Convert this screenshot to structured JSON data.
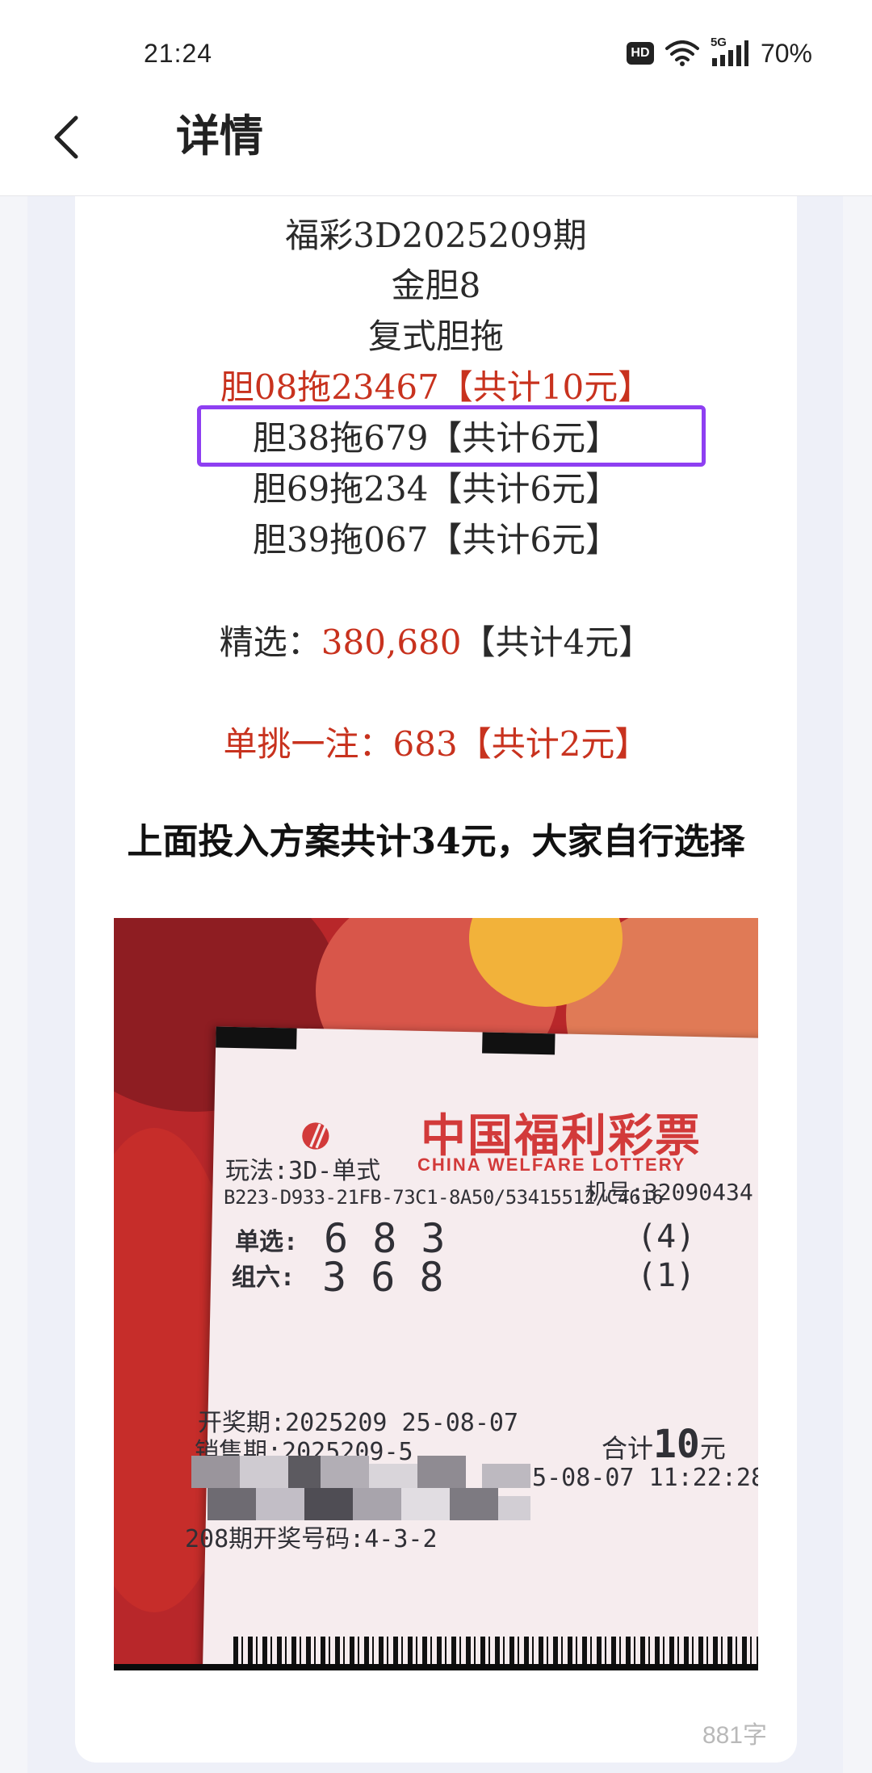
{
  "status_bar": {
    "time": "21:24",
    "hd_label": "HD",
    "network_label": "5G",
    "battery": "70%"
  },
  "header": {
    "title": "详情"
  },
  "article": {
    "line1": "福彩3D2025209期",
    "line2": "金胆8",
    "line3": "复式胆拖",
    "plans": [
      {
        "text": "胆08拖23467【共计10元】",
        "color": "#c8321e"
      },
      {
        "text": "胆38拖679【共计6元】",
        "color": "#2a2a2a",
        "highlighted": true
      },
      {
        "text": "胆69拖234【共计6元】",
        "color": "#2a2a2a"
      },
      {
        "text": "胆39拖067【共计6元】",
        "color": "#2a2a2a"
      }
    ],
    "selection": {
      "label": "精选：",
      "numbers": "380,680",
      "cost": "【共计4元】"
    },
    "single_pick": "单挑一注：683【共计2元】",
    "summary": "上面投入方案共计34元，大家自行选择",
    "word_count": "881字"
  },
  "ticket": {
    "brand_cn": "中国福利彩票",
    "brand_en": "CHINA WELFARE LOTTERY",
    "play_type": "玩法:3D-单式",
    "machine_no": "机号:32090434",
    "serial": "B223-D933-21FB-73C1-8A50/53415512/C4616",
    "single_label": "单选:",
    "single_numbers": "6  8  3",
    "single_mult": "(4)",
    "group_label": "组六:",
    "group_numbers": "3  6  8",
    "group_mult": "(1)",
    "draw_period": "开奖期:2025209 25-08-07",
    "sale_period": "销售期:2025209-5",
    "total_label": "合计",
    "total_amount": "10",
    "total_unit": "元",
    "sale_time": "25-08-07 11:22:28",
    "prev_draw": "208期开奖号码:4-3-2"
  },
  "colors": {
    "accent_red": "#c8321e",
    "highlight_border": "#8e3ff2",
    "ticket_red": "#d23a3a"
  },
  "icons": {
    "back": "chevron-left-icon",
    "wifi": "wifi-icon",
    "signal": "signal-icon"
  }
}
